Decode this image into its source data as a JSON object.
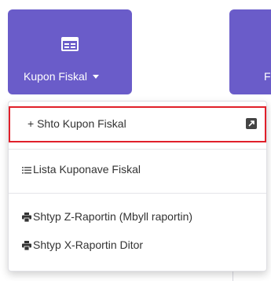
{
  "nav": {
    "kupon_fiskal": {
      "label": "Kupon Fiskal",
      "icon": "receipt-icon"
    },
    "next_button": {
      "label": "F"
    }
  },
  "dropdown": {
    "items": [
      {
        "label": "+ Shto Kupon Fiskal",
        "icon": "external-link-icon"
      },
      {
        "label": "Lista Kuponave Fiskal",
        "icon": "list-icon"
      },
      {
        "label": "Shtyp Z-Raportin (Mbyll raportin)",
        "icon": "printer-icon"
      },
      {
        "label": "Shtyp X-Raportin Ditor",
        "icon": "printer-icon"
      }
    ]
  },
  "colors": {
    "nav_bg": "#6a5cc9",
    "highlight_border": "#e0202a"
  }
}
